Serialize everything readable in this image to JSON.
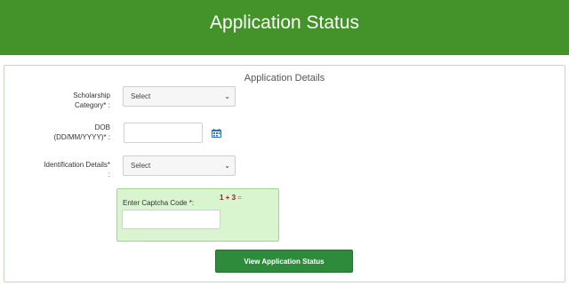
{
  "header": {
    "title": "Application Status"
  },
  "form": {
    "title": "Application Details",
    "scholarship_label_1": "Scholarship",
    "scholarship_label_2": "Category* :",
    "scholarship_value": "Select",
    "dob_label_1": "DOB",
    "dob_label_2": "(DD/MM/YYYY)* :",
    "dob_value": "",
    "ident_label_1": "Identification Details*",
    "ident_label_2": ":",
    "ident_value": "Select",
    "captcha_label": "Enter Captcha Code *:",
    "captcha_question": "1 + 3",
    "captcha_eq": "=",
    "captcha_value": "",
    "submit_label": "View Application Status"
  },
  "icons": {
    "calendar": "calendar-icon",
    "chevron": "chevron-down-icon"
  },
  "colors": {
    "header": "#43922a",
    "button": "#2e8b3b",
    "captcha_bg": "#d8f5cf"
  }
}
